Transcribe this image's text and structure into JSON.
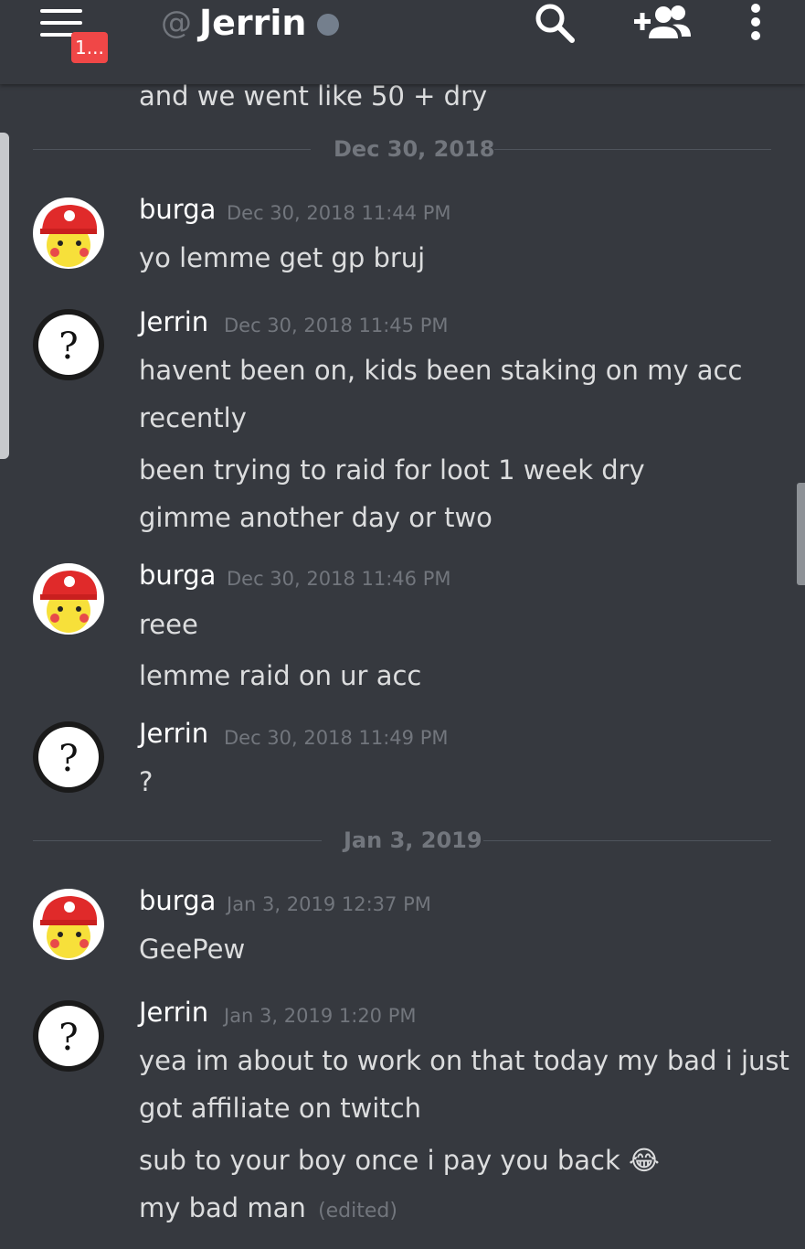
{
  "header": {
    "at_symbol": "@",
    "channel_name": "Jerrin",
    "notification_badge": "1...",
    "icons": [
      "hamburger-menu-icon",
      "search-icon",
      "add-friend-icon",
      "more-options-icon"
    ],
    "status_color": "#747f8d"
  },
  "top_partial_message": "and we went like 50 + dry",
  "dividers": [
    {
      "label": "Dec 30, 2018"
    },
    {
      "label": "Jan 3, 2019"
    }
  ],
  "groups": [
    {
      "author": "burga",
      "timestamp": "Dec 30, 2018 11:44 PM",
      "lines": [
        "yo lemme get gp bruj"
      ]
    },
    {
      "author": "Jerrin",
      "timestamp": "Dec 30, 2018 11:45 PM",
      "lines": [
        "havent been on, kids been staking on my acc",
        "recently",
        "been trying to raid for loot 1 week dry",
        "gimme another day or two"
      ]
    },
    {
      "author": "burga",
      "timestamp": "Dec 30, 2018 11:46 PM",
      "lines": [
        "reee",
        "lemme raid on ur acc"
      ]
    },
    {
      "author": "Jerrin",
      "timestamp": "Dec 30, 2018 11:49 PM",
      "lines": [
        "?"
      ]
    },
    {
      "author": "burga",
      "timestamp": "Jan 3, 2019 12:37 PM",
      "lines": [
        "GeePew"
      ]
    },
    {
      "author": "Jerrin",
      "timestamp": "Jan 3, 2019 1:20 PM",
      "lines": [
        "yea im about to work on that today my bad i just",
        "got affiliate on twitch",
        "sub to your boy once i pay you back",
        "my bad man"
      ],
      "emoji": "😂",
      "edited_label": "(edited)"
    }
  ],
  "colors": {
    "background": "#36393f",
    "text": "#dcddde",
    "muted": "#72767d",
    "badge": "#f04747"
  }
}
